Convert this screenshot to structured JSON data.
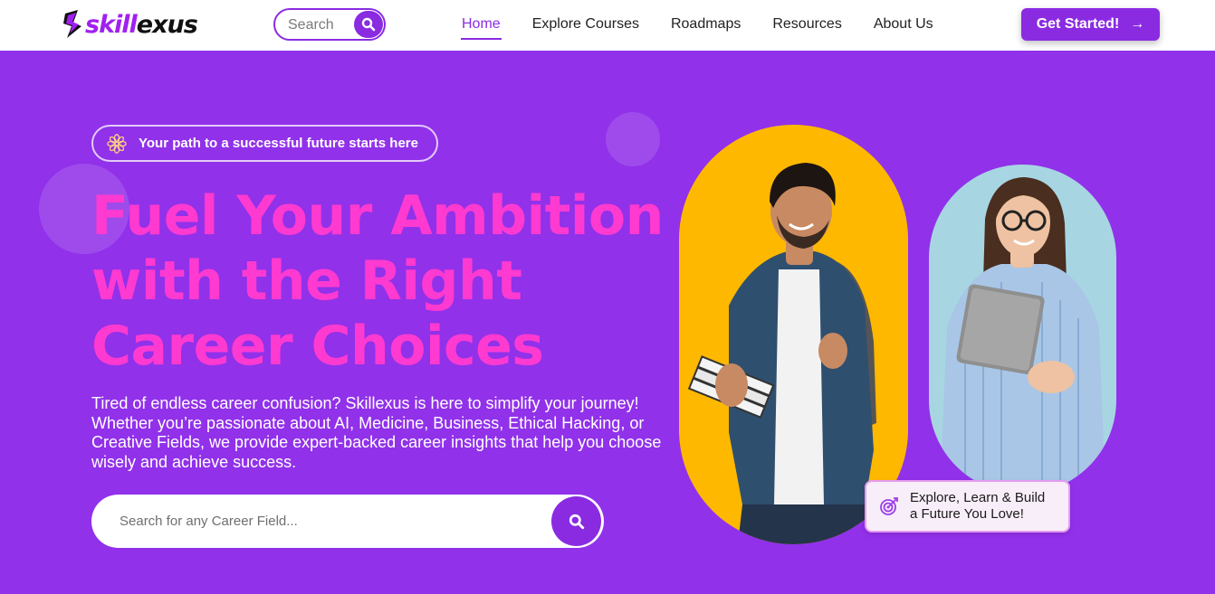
{
  "brand": {
    "name_part1": "skill",
    "name_part2": "exus"
  },
  "nav": {
    "search_placeholder": "Search",
    "links": [
      {
        "label": "Home",
        "active": true
      },
      {
        "label": "Explore Courses",
        "active": false
      },
      {
        "label": "Roadmaps",
        "active": false
      },
      {
        "label": "Resources",
        "active": false
      },
      {
        "label": "About Us",
        "active": false
      }
    ],
    "cta_label": "Get Started!",
    "cta_icon": "arrow-right-icon"
  },
  "hero": {
    "tagline": "Your path to a successful future starts here",
    "tagline_icon": "flower-icon",
    "headline_lines": [
      "Fuel Your Ambition",
      "with the Right",
      "Career Choices"
    ],
    "description": "Tired of endless career confusion? Skillexus is here to simplify your journey! Whether you’re passionate about AI, Medicine, Business, Ethical Hacking, or Creative Fields, we provide expert-backed career insights that help you choose wisely and achieve success.",
    "search_placeholder": "Search for any Career Field...",
    "search_icon": "search-icon"
  },
  "caption_card": {
    "icon": "target-icon",
    "line1": "Explore, Learn & Build",
    "line2": "a Future You Love!"
  },
  "colors": {
    "primary": "#8a2be2",
    "hero_bg": "#9131ea",
    "headline": "#ff3ad0",
    "orange_card": "#ffb800",
    "blue_card": "#a7d6e2"
  }
}
